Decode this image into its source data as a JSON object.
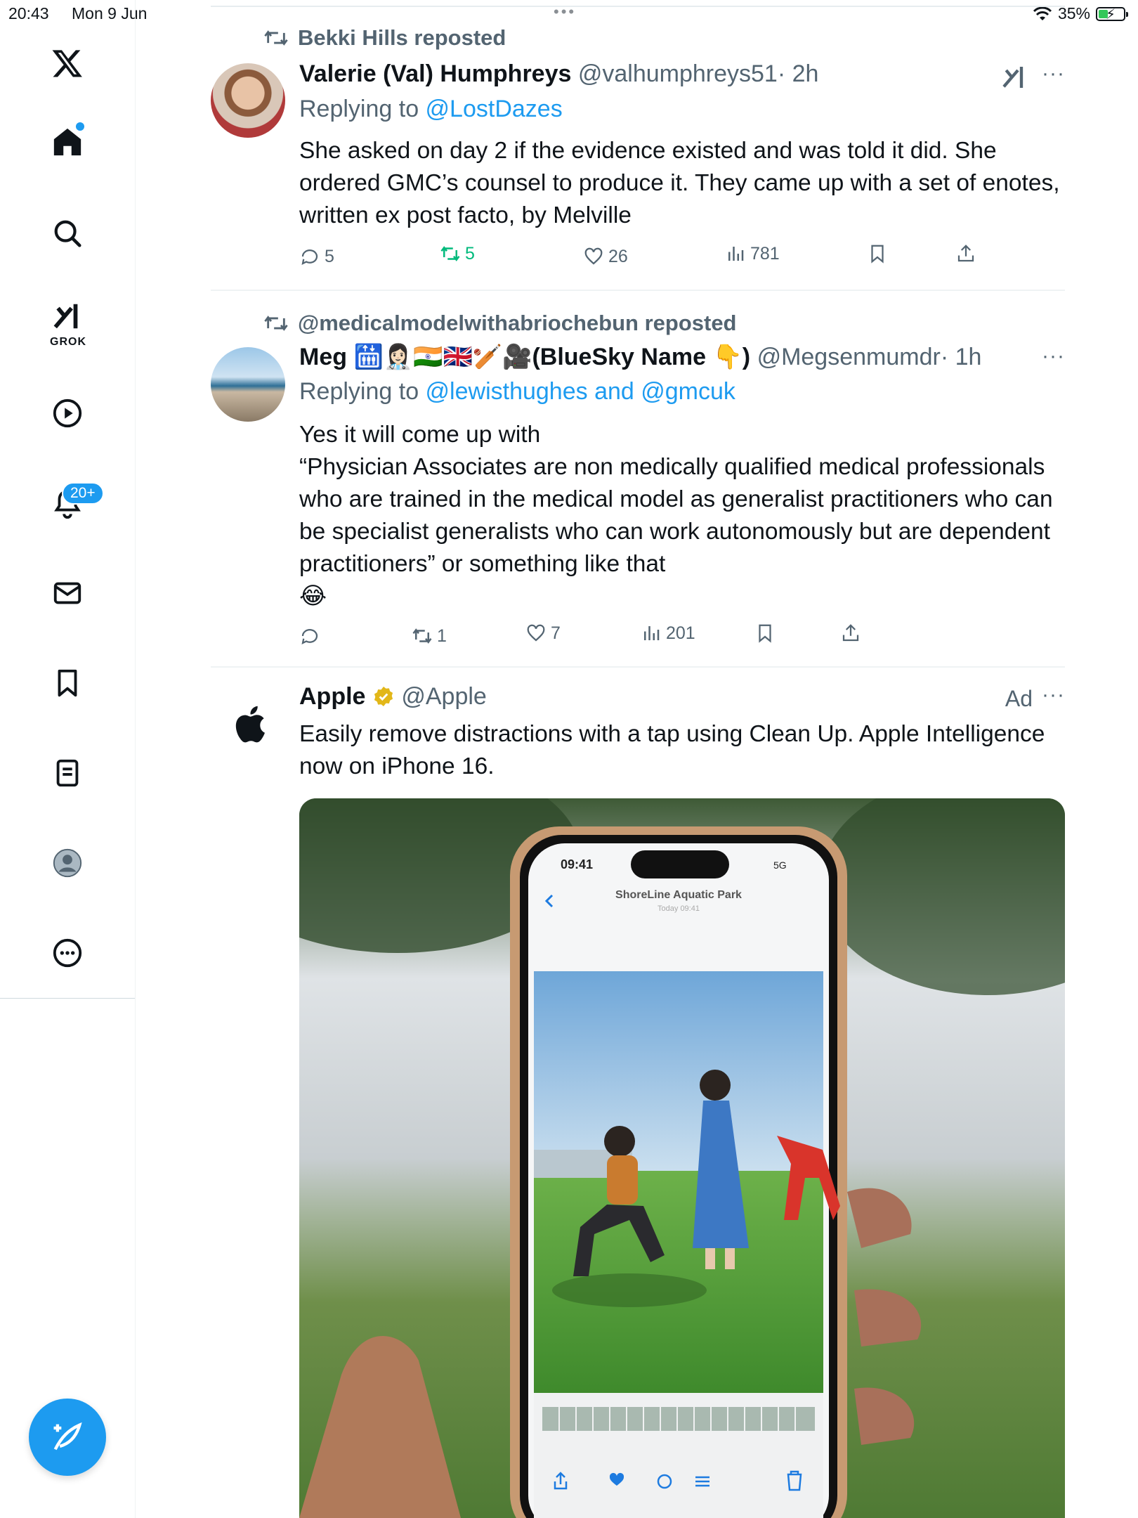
{
  "status_bar": {
    "time": "20:43",
    "date": "Mon 9 Jun",
    "battery": "35%"
  },
  "sidebar": {
    "grok_label": "GROK",
    "notifications_badge": "20+",
    "items": [
      "home",
      "explore",
      "grok",
      "videos",
      "notifications",
      "messages",
      "bookmarks",
      "lists",
      "profile",
      "more"
    ]
  },
  "posts": [
    {
      "repost_by": "Bekki Hills reposted",
      "name": "Valerie (Val) Humphreys",
      "handle": "@valhumphreys51",
      "time": "· 2h",
      "replying_prefix": "Replying to ",
      "replying_to": "@LostDazes",
      "text": "She asked on day 2 if the evidence existed and was told it did. She ordered GMC’s counsel to produce it. They came up with a set of enotes, written ex post facto, by Melville",
      "replies": "5",
      "reposts": "5",
      "likes": "26",
      "views": "781"
    },
    {
      "repost_by": "@medicalmodelwithabriochebun reposted",
      "name": "Meg 🛗👩🏻‍⚕️🇮🇳🇬🇧🏏🎥(BlueSky Name 👇)",
      "handle": "@Megsenmumdr",
      "time": "· 1h",
      "replying_prefix": "Replying to ",
      "replying_to": "@lewisthughes and @gmcuk",
      "text": "Yes it will come up with\n“Physician Associates are non medically qualified medical professionals who are trained in the medical model as generalist practitioners who can be specialist generalists who can work autonomously but are dependent practitioners” or something like that\n😂",
      "replies": "",
      "reposts": "1",
      "likes": "7",
      "views": "201"
    }
  ],
  "ad": {
    "name": "Apple",
    "handle": "@Apple",
    "label": "Ad",
    "text": "Easily remove distractions with a tap using Clean Up. Apple Intelligence now on iPhone 16.",
    "phone_time": "09:41",
    "phone_signal": "5G",
    "phone_title": "ShoreLine Aquatic Park",
    "phone_subtitle": "Today 09:41"
  },
  "colors": {
    "accent": "#1d9bf0",
    "repost_green": "#00ba7c",
    "secondary_text": "#536471"
  }
}
